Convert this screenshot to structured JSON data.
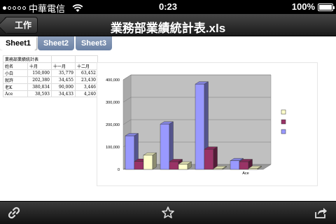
{
  "status_bar": {
    "carrier": "中華電信",
    "time": "0:23",
    "battery": "100%",
    "battery_level": 1.0
  },
  "nav": {
    "back_label": "工作",
    "title": "業務部業績統計表.xls"
  },
  "tabs": [
    {
      "label": "Sheet1",
      "active": true
    },
    {
      "label": "Sheet2",
      "active": false
    },
    {
      "label": "Sheet3",
      "active": false
    }
  ],
  "sheet": {
    "title": "業務部業績統計表",
    "header": [
      "姓名",
      "十月",
      "十一月",
      "十二月"
    ],
    "rows": [
      [
        "小白",
        "150,000",
        "35,779",
        "63,452"
      ],
      [
        "就許",
        "202,380",
        "34,455",
        "23,430"
      ],
      [
        "老K",
        "380,834",
        "90,000",
        "3,446"
      ],
      [
        "Ace",
        "38,593",
        "34,433",
        "4,240"
      ]
    ]
  },
  "chart_data": {
    "type": "bar",
    "style": "3d-clustered-column",
    "categories": [
      "",
      "",
      "",
      "Ace"
    ],
    "series": [
      {
        "color": "#9999ff",
        "values": [
          150000,
          202380,
          380834,
          38593
        ]
      },
      {
        "color": "#993366",
        "values": [
          35779,
          34455,
          90000,
          34433
        ]
      },
      {
        "color": "#ffffcc",
        "values": [
          63452,
          23430,
          3446,
          4240
        ]
      }
    ],
    "y_ticks": [
      "0",
      "100,000",
      "200,000",
      "300,000",
      "400,000"
    ],
    "ylim": [
      0,
      400000
    ],
    "legend_position": "right"
  },
  "toolbar": {
    "icons": [
      "link-icon",
      "star-icon",
      "share-icon"
    ]
  }
}
